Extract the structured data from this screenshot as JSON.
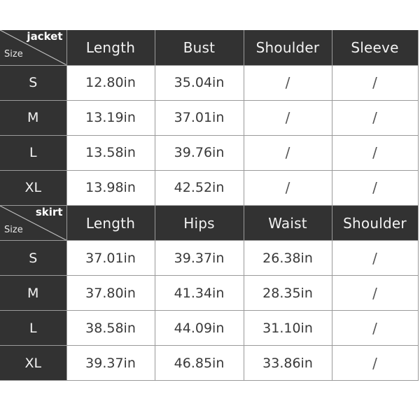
{
  "document": {
    "kind": "size-chart",
    "colors": {
      "header_bg": "#323232",
      "header_text": "#f2f2f2",
      "cell_bg": "#ffffff",
      "cell_text": "#3a3a3a",
      "grid_line": "#9a9a9a",
      "page_bg": "#ffffff"
    }
  },
  "tables": [
    {
      "corner": {
        "category_label": "jacket",
        "size_label": "Size"
      },
      "columns": [
        "Length",
        "Bust",
        "Shoulder",
        "Sleeve"
      ],
      "rows": [
        {
          "size": "S",
          "values": [
            "12.80in",
            "35.04in",
            "/",
            "/"
          ]
        },
        {
          "size": "M",
          "values": [
            "13.19in",
            "37.01in",
            "/",
            "/"
          ]
        },
        {
          "size": "L",
          "values": [
            "13.58in",
            "39.76in",
            "/",
            "/"
          ]
        },
        {
          "size": "XL",
          "values": [
            "13.98in",
            "42.52in",
            "/",
            "/"
          ]
        }
      ]
    },
    {
      "corner": {
        "category_label": "skirt",
        "size_label": "Size"
      },
      "columns": [
        "Length",
        "Hips",
        "Waist",
        "Shoulder"
      ],
      "rows": [
        {
          "size": "S",
          "values": [
            "37.01in",
            "39.37in",
            "26.38in",
            "/"
          ]
        },
        {
          "size": "M",
          "values": [
            "37.80in",
            "41.34in",
            "28.35in",
            "/"
          ]
        },
        {
          "size": "L",
          "values": [
            "38.58in",
            "44.09in",
            "31.10in",
            "/"
          ]
        },
        {
          "size": "XL",
          "values": [
            "39.37in",
            "46.85in",
            "33.86in",
            "/"
          ]
        }
      ]
    }
  ]
}
